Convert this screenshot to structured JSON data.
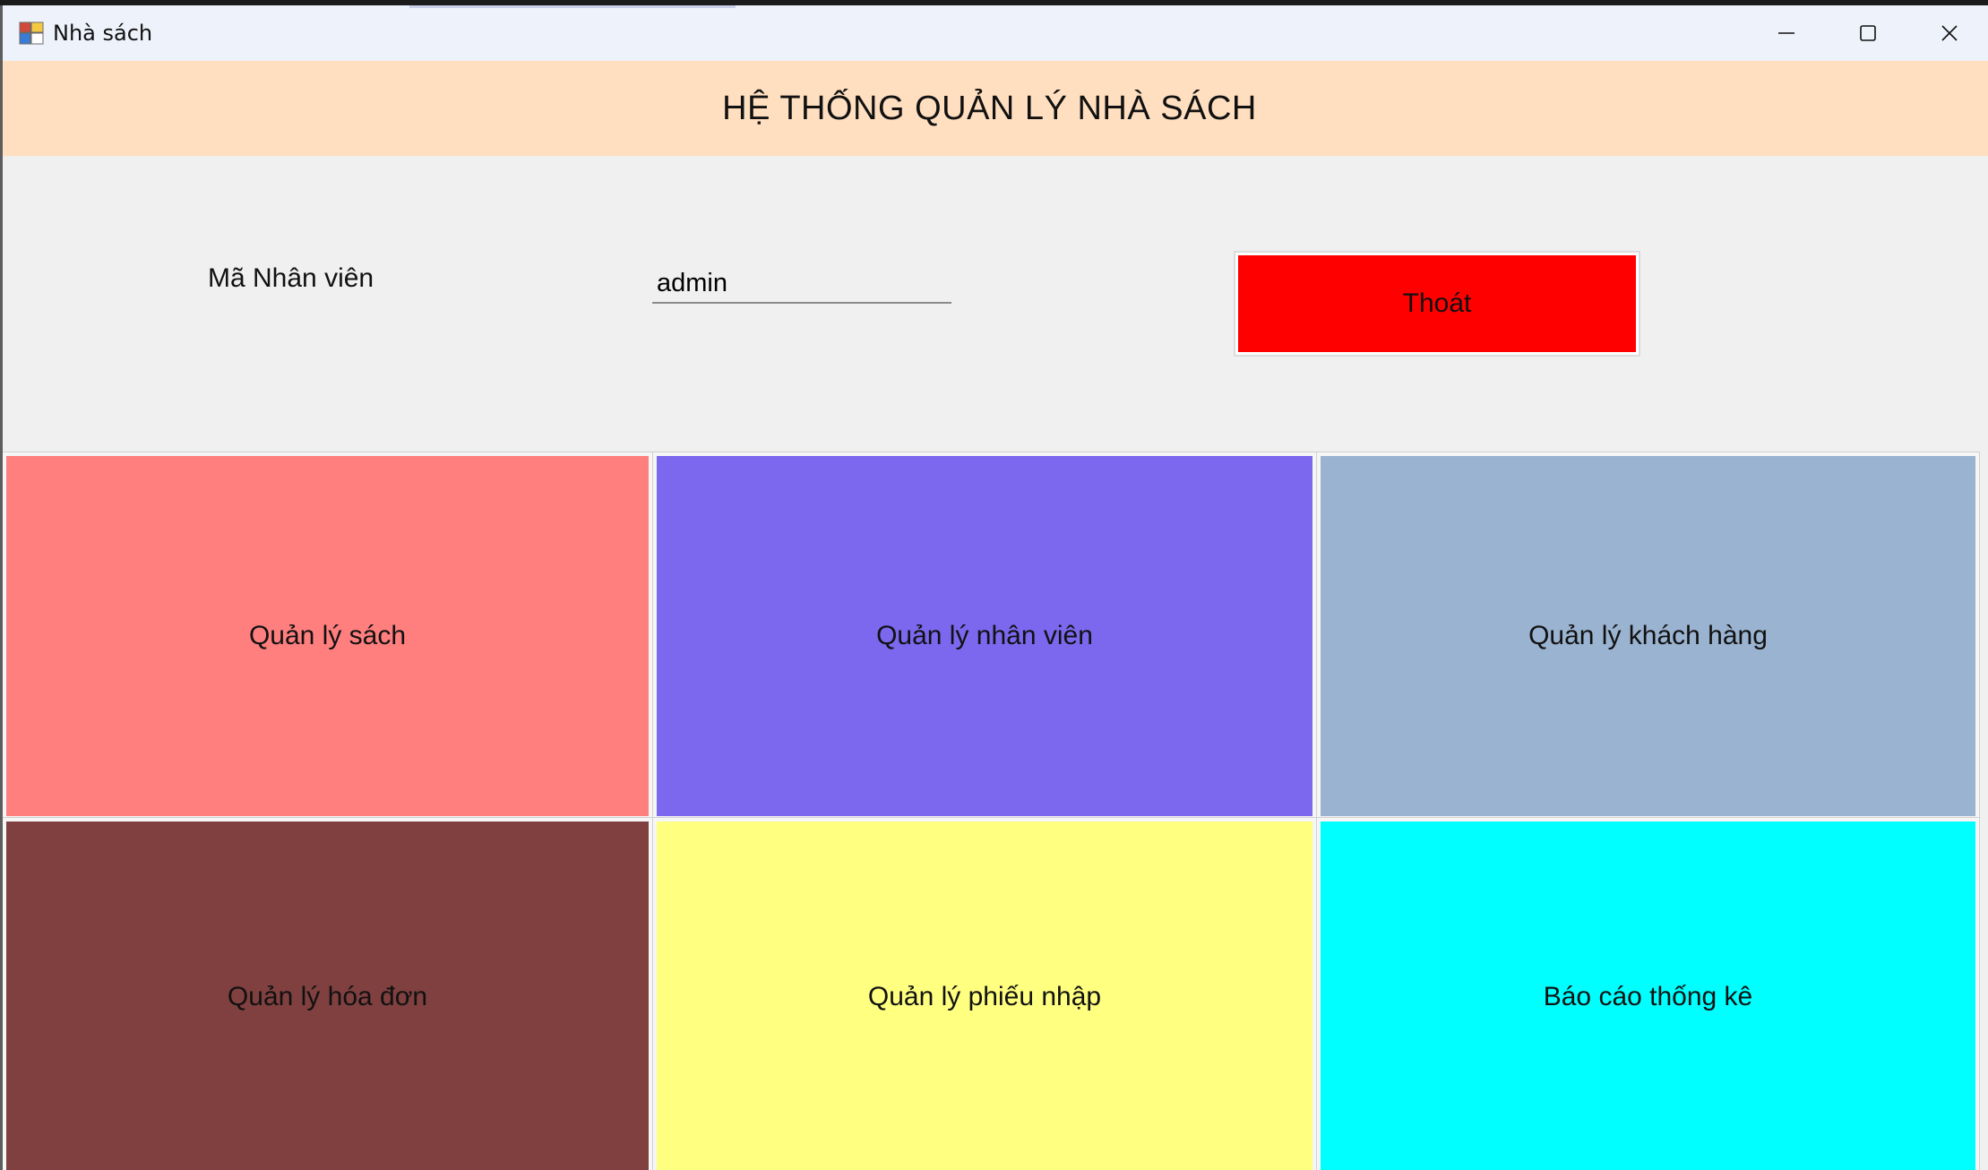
{
  "window": {
    "title": "Nhà sách",
    "icon": "app-grid-icon",
    "controls": {
      "minimize": "minimize-icon",
      "maximize": "maximize-icon",
      "close": "close-icon"
    }
  },
  "header": {
    "title": "HỆ THỐNG QUẢN LÝ NHÀ SÁCH",
    "background": "#ffdfc0"
  },
  "employee": {
    "label": "Mã Nhân viên",
    "value": "admin"
  },
  "exit_button": {
    "label": "Thoát",
    "color": "#ff0000"
  },
  "tiles": [
    {
      "label": "Quản lý sách",
      "color": "#ff7f7f"
    },
    {
      "label": "Quản lý nhân viên",
      "color": "#7b68ee"
    },
    {
      "label": "Quản lý khách hàng",
      "color": "#9ab3d0"
    },
    {
      "label": "Quản lý hóa đơn",
      "color": "#804040"
    },
    {
      "label": "Quản lý phiếu nhập",
      "color": "#ffff80"
    },
    {
      "label": "Báo cáo thống kê",
      "color": "#00ffff"
    }
  ]
}
